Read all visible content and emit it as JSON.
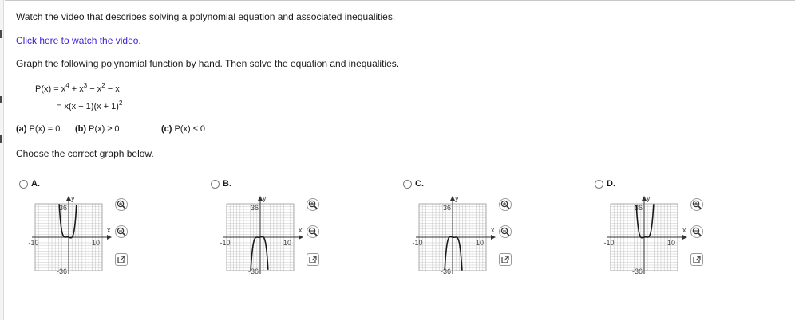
{
  "intro": "Watch the video that describes solving a polynomial equation and associated inequalities.",
  "video_link": "Click here to watch the video.",
  "instruction": "Graph the following polynomial function by hand. Then solve the equation and inequalities.",
  "equation": {
    "line1": {
      "lhs": "P(x) = x",
      "e1": "4",
      "t2": " + x",
      "e2": "3",
      "t3": " − x",
      "e3": "2",
      "t4": " − x"
    },
    "line2": {
      "text": "= x(x − 1)(x + 1)",
      "exp": "2"
    }
  },
  "parts": [
    {
      "label": "(a)",
      "text": "P(x) = 0"
    },
    {
      "label": "(b)",
      "text": "P(x) ≥ 0"
    },
    {
      "label": "(c)",
      "text": "P(x) ≤ 0"
    }
  ],
  "prompt": "Choose the correct graph below.",
  "axis_labels": {
    "y": "y",
    "x": "x",
    "ytop": "36",
    "ybottom": "-36",
    "xleft": "-10",
    "xright": "10"
  },
  "options": [
    {
      "letter": "A.",
      "graph": "A"
    },
    {
      "letter": "B.",
      "graph": "B"
    },
    {
      "letter": "C.",
      "graph": "C"
    },
    {
      "letter": "D.",
      "graph": "D"
    }
  ],
  "icons": {
    "zoom_in": "zoom-in-icon",
    "zoom_out": "zoom-out-icon",
    "popout": "popout-icon"
  },
  "colors": {
    "link": "#3a1fd6",
    "curve": "#1a1a1a",
    "grid": "#c8c8c8"
  }
}
